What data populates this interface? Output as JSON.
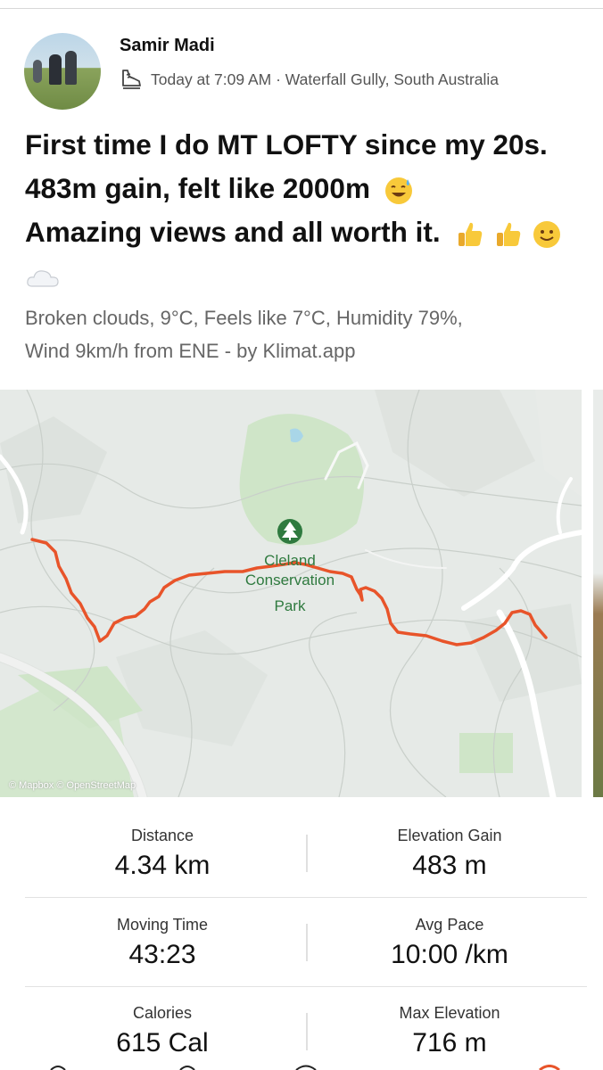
{
  "post": {
    "author": "Samir Madi",
    "meta": "Today at 7:09 AM · Waterfall Gully, South Australia",
    "title_lines": [
      "First time I do MT LOFTY since my 20s.",
      "483m gain, felt like 2000m",
      "Amazing views and all worth it."
    ],
    "description_lines": [
      "Broken clouds, 9°C, Feels like 7°C, Humidity 79%,",
      "Wind 9km/h from ENE - by Klimat.app"
    ]
  },
  "map": {
    "park_label_line1": "Cleland",
    "park_label_line2": "Conservation",
    "park_label_line3": "Park",
    "attribution": "© Mapbox © OpenStreetMap",
    "route_color": "#e8542a",
    "park_color": "#cfe5c8",
    "label_color": "#2f7a3f"
  },
  "stats": [
    {
      "label": "Distance",
      "value": "4.34 km"
    },
    {
      "label": "Elevation Gain",
      "value": "483 m"
    },
    {
      "label": "Moving Time",
      "value": "43:23"
    },
    {
      "label": "Avg Pace",
      "value": "10:00 /km"
    },
    {
      "label": "Calories",
      "value": "615 Cal"
    },
    {
      "label": "Max Elevation",
      "value": "716 m"
    }
  ],
  "icons": {
    "activity": "hiking-shoe-icon",
    "park": "tree-icon",
    "emoji_1": "sweat-smile-emoji",
    "emoji_2": "thumbs-up-emoji",
    "emoji_3": "slightly-smiling-emoji",
    "emoji_4": "cloud-emoji"
  }
}
